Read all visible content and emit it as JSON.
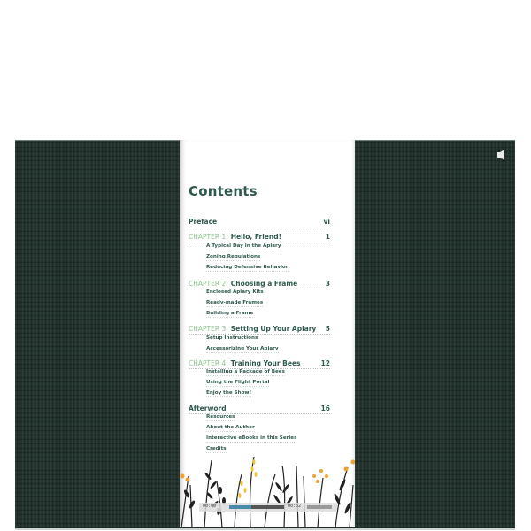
{
  "toc": {
    "title": "Contents",
    "preface": {
      "label": "Preface",
      "page": "vi"
    },
    "chapters": [
      {
        "prefix": "CHAPTER 1:",
        "title": "Hello, Friend!",
        "page": "1",
        "sections": [
          "A Typical Day in the Apiary",
          "Zoning Regulations",
          "Reducing Defensive Behavior"
        ]
      },
      {
        "prefix": "CHAPTER 2:",
        "title": "Choosing a Frame",
        "page": "3",
        "sections": [
          "Enclosed Apiary Kits",
          "Ready-made Frames",
          "Building a Frame"
        ]
      },
      {
        "prefix": "CHAPTER 3:",
        "title": "Setting Up Your Apiary",
        "page": "5",
        "sections": [
          "Setup Instructions",
          "Accessorizing Your Apiary"
        ]
      },
      {
        "prefix": "CHAPTER 4:",
        "title": "Training Your Bees",
        "page": "12",
        "sections": [
          "Installing a Package of Bees",
          "Using the Flight Portal",
          "Enjoy the Show!"
        ]
      }
    ],
    "afterword": {
      "label": "Afterword",
      "page": "16",
      "sections": [
        "Resources",
        "About the Author",
        "Interactive eBooks in this Series",
        "Credits"
      ]
    }
  },
  "player": {
    "current_time": "00:00",
    "duration": "00:52",
    "progress_percent": 40
  },
  "icons": {
    "speaker": "speaker-icon"
  },
  "colors": {
    "background": "#1f302b",
    "title": "#2f5a50",
    "chapter_label": "#8cc28c",
    "progress": "#4a8aa8",
    "flower_orange": "#f0a030",
    "flower_yellow": "#f2c230"
  }
}
